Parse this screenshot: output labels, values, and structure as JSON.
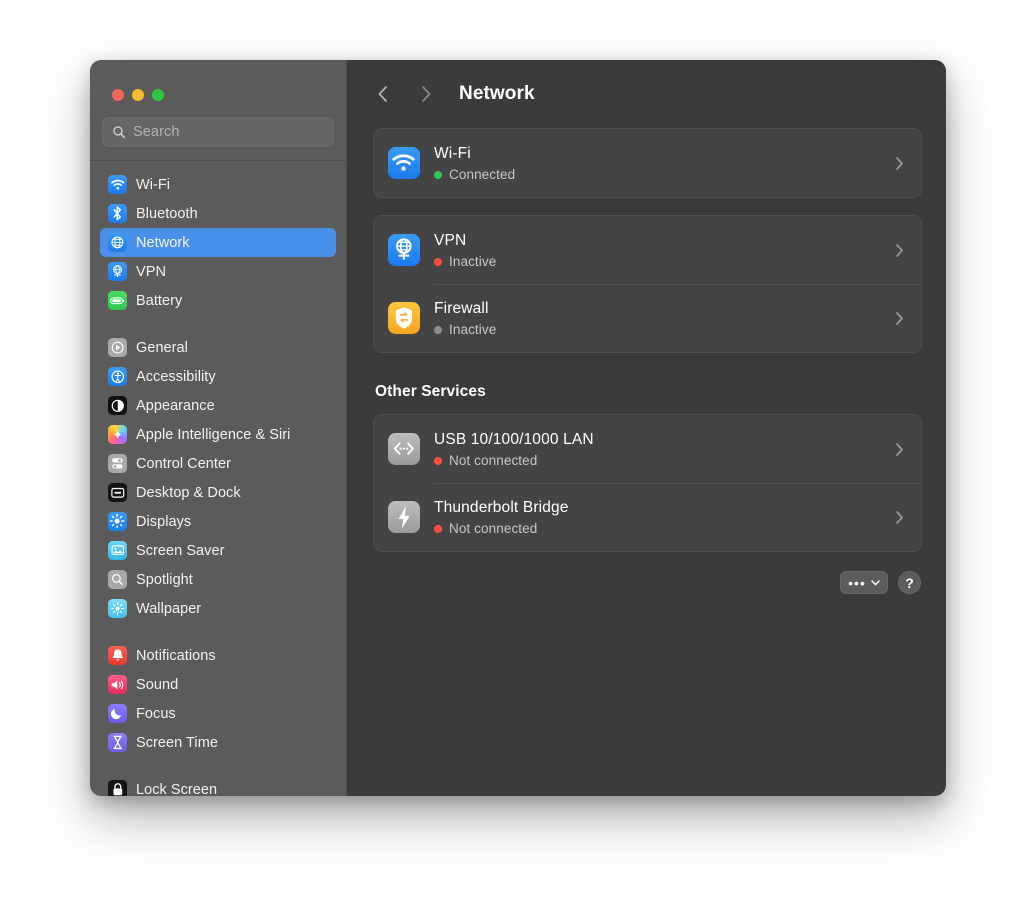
{
  "window": {
    "traffic_lights": [
      {
        "name": "close",
        "color": "#f4655a"
      },
      {
        "name": "minimize",
        "color": "#f6bc2f"
      },
      {
        "name": "maximize",
        "color": "#2fc73f"
      }
    ]
  },
  "sidebar": {
    "search": {
      "placeholder": "Search",
      "value": ""
    },
    "groups": [
      {
        "items": [
          {
            "label": "Wi-Fi",
            "icon": "wifi-icon",
            "selected": false
          },
          {
            "label": "Bluetooth",
            "icon": "bluetooth-icon",
            "selected": false
          },
          {
            "label": "Network",
            "icon": "network-globe-icon",
            "selected": true
          },
          {
            "label": "VPN",
            "icon": "vpn-icon",
            "selected": false
          },
          {
            "label": "Battery",
            "icon": "battery-icon",
            "selected": false
          }
        ]
      },
      {
        "items": [
          {
            "label": "General",
            "icon": "general-gear-icon",
            "selected": false
          },
          {
            "label": "Accessibility",
            "icon": "accessibility-icon",
            "selected": false
          },
          {
            "label": "Appearance",
            "icon": "appearance-icon",
            "selected": false
          },
          {
            "label": "Apple Intelligence & Siri",
            "icon": "apple-intelligence-icon",
            "selected": false
          },
          {
            "label": "Control Center",
            "icon": "control-center-icon",
            "selected": false
          },
          {
            "label": "Desktop & Dock",
            "icon": "desktop-dock-icon",
            "selected": false
          },
          {
            "label": "Displays",
            "icon": "displays-icon",
            "selected": false
          },
          {
            "label": "Screen Saver",
            "icon": "screen-saver-icon",
            "selected": false
          },
          {
            "label": "Spotlight",
            "icon": "spotlight-icon",
            "selected": false
          },
          {
            "label": "Wallpaper",
            "icon": "wallpaper-icon",
            "selected": false
          }
        ]
      },
      {
        "items": [
          {
            "label": "Notifications",
            "icon": "notifications-icon",
            "selected": false
          },
          {
            "label": "Sound",
            "icon": "sound-icon",
            "selected": false
          },
          {
            "label": "Focus",
            "icon": "focus-moon-icon",
            "selected": false
          },
          {
            "label": "Screen Time",
            "icon": "screen-time-icon",
            "selected": false
          }
        ]
      },
      {
        "items": [
          {
            "label": "Lock Screen",
            "icon": "lock-screen-icon",
            "selected": false
          }
        ]
      }
    ]
  },
  "toolbar": {
    "back_label": "‹",
    "forward_label": "›",
    "title": "Network"
  },
  "main": {
    "primary_card": [
      {
        "name": "Wi-Fi",
        "status": "Connected",
        "status_color": "#34c759",
        "icon": "wifi-icon"
      }
    ],
    "services_card": [
      {
        "name": "VPN",
        "status": "Inactive",
        "status_color": "#ff4f3f",
        "icon": "vpn-globe-icon"
      },
      {
        "name": "Firewall",
        "status": "Inactive",
        "status_color": "#8e8e8e",
        "icon": "firewall-shield-icon"
      }
    ],
    "other_services_heading": "Other Services",
    "other_services_card": [
      {
        "name": "USB 10/100/1000 LAN",
        "status": "Not connected",
        "status_color": "#ff4f3f",
        "icon": "ethernet-icon"
      },
      {
        "name": "Thunderbolt Bridge",
        "status": "Not connected",
        "status_color": "#ff4f3f",
        "icon": "thunderbolt-icon"
      }
    ],
    "more_button_label": "•••",
    "help_button_label": "?"
  },
  "colors": {
    "accent": "#4a90e8",
    "sidebar_bg": "#5b5b5b",
    "content_bg": "#3b3b3b",
    "card_bg": "#444444"
  }
}
